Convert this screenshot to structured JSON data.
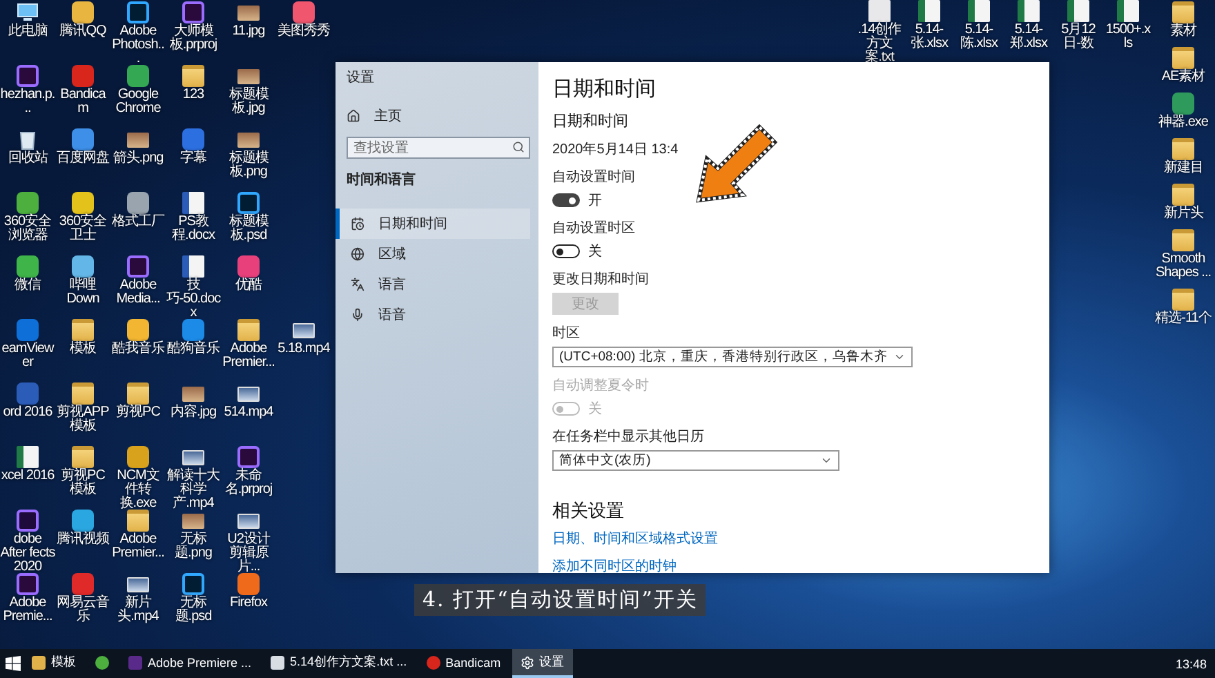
{
  "desktop": {
    "left_rows": [
      [
        {
          "label": "此电脑",
          "kind": "pc"
        },
        {
          "label": "腾讯QQ",
          "kind": "app",
          "color": "#e8b640"
        },
        {
          "label": "Adobe Photosh...",
          "kind": "ps"
        },
        {
          "label": "大师模板.prproj",
          "kind": "pr"
        },
        {
          "label": "11.jpg",
          "kind": "image"
        },
        {
          "label": "美图秀秀",
          "kind": "app",
          "color": "#f0566e"
        }
      ],
      [
        {
          "label": "hezhan.p...",
          "kind": "pr"
        },
        {
          "label": "Bandicam",
          "kind": "app",
          "color": "#d8261c"
        },
        {
          "label": "Google Chrome",
          "kind": "app",
          "color": "#35a853"
        },
        {
          "label": "123",
          "kind": "folder"
        },
        {
          "label": "标题模板.jpg",
          "kind": "image"
        }
      ],
      [
        {
          "label": "回收站",
          "kind": "recycle"
        },
        {
          "label": "百度网盘",
          "kind": "app",
          "color": "#3d8fe8"
        },
        {
          "label": "箭头.png",
          "kind": "image"
        },
        {
          "label": "字幕",
          "kind": "app",
          "color": "#2c6fe0"
        },
        {
          "label": "标题模板.png",
          "kind": "image"
        }
      ],
      [
        {
          "label": "360安全浏览器",
          "kind": "app",
          "color": "#4caf3e"
        },
        {
          "label": "360安全卫士",
          "kind": "app",
          "color": "#e3c21c"
        },
        {
          "label": "格式工厂",
          "kind": "app",
          "color": "#9aa4ae"
        },
        {
          "label": "PS教程.docx",
          "kind": "word"
        },
        {
          "label": "标题模板.psd",
          "kind": "ps"
        }
      ],
      [
        {
          "label": "微信",
          "kind": "app",
          "color": "#3fb449"
        },
        {
          "label": "哔哩Down",
          "kind": "app",
          "color": "#63b7e8"
        },
        {
          "label": "Adobe Media...",
          "kind": "pr"
        },
        {
          "label": "技巧-50.docx",
          "kind": "word"
        },
        {
          "label": "优酷",
          "kind": "app",
          "color": "#e8407a"
        }
      ],
      [
        {
          "label": "eamViewer",
          "kind": "app",
          "color": "#0e6fd8"
        },
        {
          "label": "模板",
          "kind": "folder"
        },
        {
          "label": "酷我音乐",
          "kind": "app",
          "color": "#f2b632"
        },
        {
          "label": "酷狗音乐",
          "kind": "app",
          "color": "#1c8be8"
        },
        {
          "label": "Adobe Premier...",
          "kind": "folder"
        },
        {
          "label": "5.18.mp4",
          "kind": "video"
        }
      ],
      [
        {
          "label": "ord 2016",
          "kind": "wordapp"
        },
        {
          "label": "剪视APP模板",
          "kind": "folder"
        },
        {
          "label": "剪视PC",
          "kind": "folder"
        },
        {
          "label": "内容.jpg",
          "kind": "image"
        },
        {
          "label": "514.mp4",
          "kind": "video"
        }
      ],
      [
        {
          "label": "xcel 2016",
          "kind": "excel"
        },
        {
          "label": "剪视PC模板",
          "kind": "folder"
        },
        {
          "label": "NCM文件转换.exe",
          "kind": "app",
          "color": "#d9a21c"
        },
        {
          "label": "解读十大科学产.mp4",
          "kind": "video"
        },
        {
          "label": "未命名.prproj",
          "kind": "pr"
        }
      ],
      [
        {
          "label": "dobe After fects 2020",
          "kind": "ae"
        },
        {
          "label": "腾讯视频",
          "kind": "app",
          "color": "#2aa6e0"
        },
        {
          "label": "Adobe Premier...",
          "kind": "folder"
        },
        {
          "label": "无标题.png",
          "kind": "image"
        },
        {
          "label": "U2设计剪辑原片...",
          "kind": "video"
        }
      ],
      [
        {
          "label": "Adobe Premie...",
          "kind": "pr"
        },
        {
          "label": "网易云音乐",
          "kind": "app",
          "color": "#e02a2a"
        },
        {
          "label": "新片头.mp4",
          "kind": "video"
        },
        {
          "label": "无标题.psd",
          "kind": "ps"
        },
        {
          "label": "Firefox",
          "kind": "app",
          "color": "#f06a1c"
        }
      ]
    ],
    "top_row": [
      {
        "label": ".14创作方文案.txt",
        "kind": "txt"
      },
      {
        "label": "5.14-张.xlsx",
        "kind": "excel"
      },
      {
        "label": "5.14-陈.xlsx",
        "kind": "excel"
      },
      {
        "label": "5.14-郑.xlsx",
        "kind": "excel"
      },
      {
        "label": "5月12日-数",
        "kind": "excel"
      },
      {
        "label": "1500+.xls",
        "kind": "excel"
      }
    ],
    "right_column": [
      {
        "label": "素材",
        "kind": "folder"
      },
      {
        "label": "AE素材",
        "kind": "folder"
      },
      {
        "label": "神器.exe",
        "kind": "app",
        "color": "#2e9a5c"
      },
      {
        "label": "新建目",
        "kind": "folder"
      },
      {
        "label": "新片头",
        "kind": "folder"
      },
      {
        "label": "Smooth Shapes ...",
        "kind": "folder"
      },
      {
        "label": "精选-11个",
        "kind": "folder"
      }
    ]
  },
  "settings_window": {
    "title": "设置",
    "home": "主页",
    "search": {
      "placeholder": "查找设置"
    },
    "section": "时间和语言",
    "nav": [
      {
        "label": "日期和时间",
        "kind": "clock",
        "selected": true
      },
      {
        "label": "区域",
        "kind": "globe",
        "selected": false
      },
      {
        "label": "语言",
        "kind": "language",
        "selected": false
      },
      {
        "label": "语音",
        "kind": "mic",
        "selected": false
      }
    ],
    "heading": "日期和时间",
    "subheading": "日期和时间",
    "items": [
      {
        "kind": "date",
        "text": "2020年5月14日  13:4"
      },
      {
        "kind": "toggle",
        "label": "自动设置时间",
        "on": true,
        "state_text": "开",
        "disabled": false
      },
      {
        "kind": "toggle",
        "label": "自动设置时区",
        "on": false,
        "state_text": "关",
        "disabled": false
      },
      {
        "kind": "button",
        "label": "更改日期和时间",
        "button": "更改",
        "disabled": true
      },
      {
        "kind": "dropdown",
        "label": "时区",
        "value": "(UTC+08:00) 北京，重庆，香港特别行政区，乌鲁木齐"
      },
      {
        "kind": "toggle",
        "label": "自动调整夏令时",
        "on": false,
        "state_text": "关",
        "disabled": true
      },
      {
        "kind": "dropdown",
        "label": "在任务栏中显示其他日历",
        "value": "简体中文(农历)"
      }
    ],
    "related": {
      "heading": "相关设置",
      "links": [
        "日期、时间和区域格式设置",
        "添加不同时区的时钟"
      ]
    }
  },
  "caption": "4. 打开“自动设置时间”开关",
  "taskbar": {
    "items": [
      {
        "label": "模板",
        "kind": "folder",
        "selected": false
      },
      {
        "kind": "browser",
        "selected": false
      },
      {
        "label": "Adobe Premiere ...",
        "kind": "pr",
        "selected": false
      },
      {
        "label": "5.14创作方文案.txt ...",
        "kind": "txt",
        "selected": false
      },
      {
        "label": "Bandicam",
        "kind": "record",
        "selected": false
      },
      {
        "label": "设置",
        "kind": "gear",
        "selected": true
      }
    ],
    "time": "13:48"
  }
}
